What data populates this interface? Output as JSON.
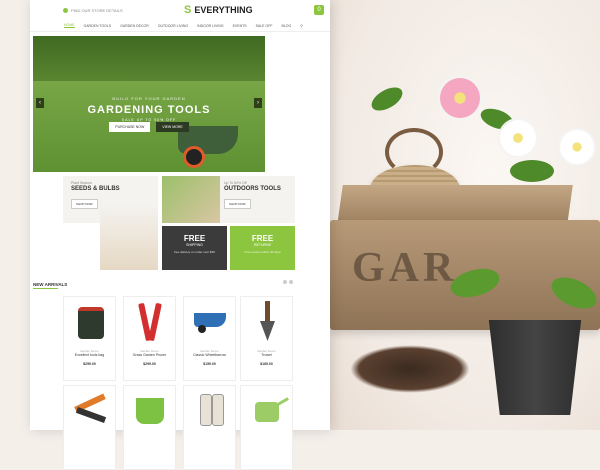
{
  "header": {
    "location_text": "FIND OUR STORE DETAILS",
    "logo_text": "EVERYTHING",
    "logo_mark": "S",
    "cart_count": "0"
  },
  "nav": {
    "items": [
      "HOME",
      "GARDEN TOOLS",
      "GARDEN DECOR",
      "OUTDOOR LIVING",
      "INDOOR LIVING",
      "EVENTS",
      "SALE OFF",
      "BLOG"
    ]
  },
  "hero": {
    "pretitle": "BUILD FOR YOUR GARDEN",
    "title": "GARDENING TOOLS",
    "subtitle": "SALE UP TO 50% OFF",
    "primary_button": "PURCHASE NOW",
    "secondary_button": "VIEW MORE",
    "prev_arrow": "‹",
    "next_arrow": "›"
  },
  "promos": [
    {
      "small": "Plant Season",
      "title": "SEEDS & BULBS",
      "button": "SHOP NOW"
    },
    {
      "small": "Up To 50% Off",
      "title": "OUTDOORS TOOLS",
      "button": "SHOP NOW"
    }
  ],
  "service_boxes": [
    {
      "title": "FREE",
      "subtitle": "SHIPPING",
      "desc": "free delivery on order over $99",
      "color": "#3b3b3b"
    },
    {
      "title": "FREE",
      "subtitle": "RETURNS",
      "desc": "Free returns within 30 days",
      "color": "#8cc63f"
    }
  ],
  "new_arrivals": {
    "title": "NEW ARRIVALS",
    "products": [
      {
        "category": "Garden Decor",
        "name": "Excellent tools bag",
        "price": "$259.00",
        "icon": "tool-bag-icon"
      },
      {
        "category": "Garden Decor",
        "name": "Grass Garden Pruner",
        "price": "$299.00",
        "icon": "pruner-icon"
      },
      {
        "category": "Garden Decor",
        "name": "Classic Wheelbarrow",
        "price": "$159.00",
        "icon": "wheelbarrow-icon"
      },
      {
        "category": "Garden Decor",
        "name": "Trowel",
        "price": "$169.00",
        "icon": "trowel-icon"
      },
      {
        "category": "",
        "name": "",
        "price": "",
        "icon": "hand-tools-icon"
      },
      {
        "category": "",
        "name": "",
        "price": "",
        "icon": "bucket-icon"
      },
      {
        "category": "",
        "name": "",
        "price": "",
        "icon": "gloves-icon"
      },
      {
        "category": "",
        "name": "",
        "price": "",
        "icon": "watering-can-icon"
      }
    ]
  },
  "decor": {
    "crate_text": "GAR"
  },
  "colors": {
    "accent": "#8cc63f",
    "dark": "#3b3b3b"
  }
}
